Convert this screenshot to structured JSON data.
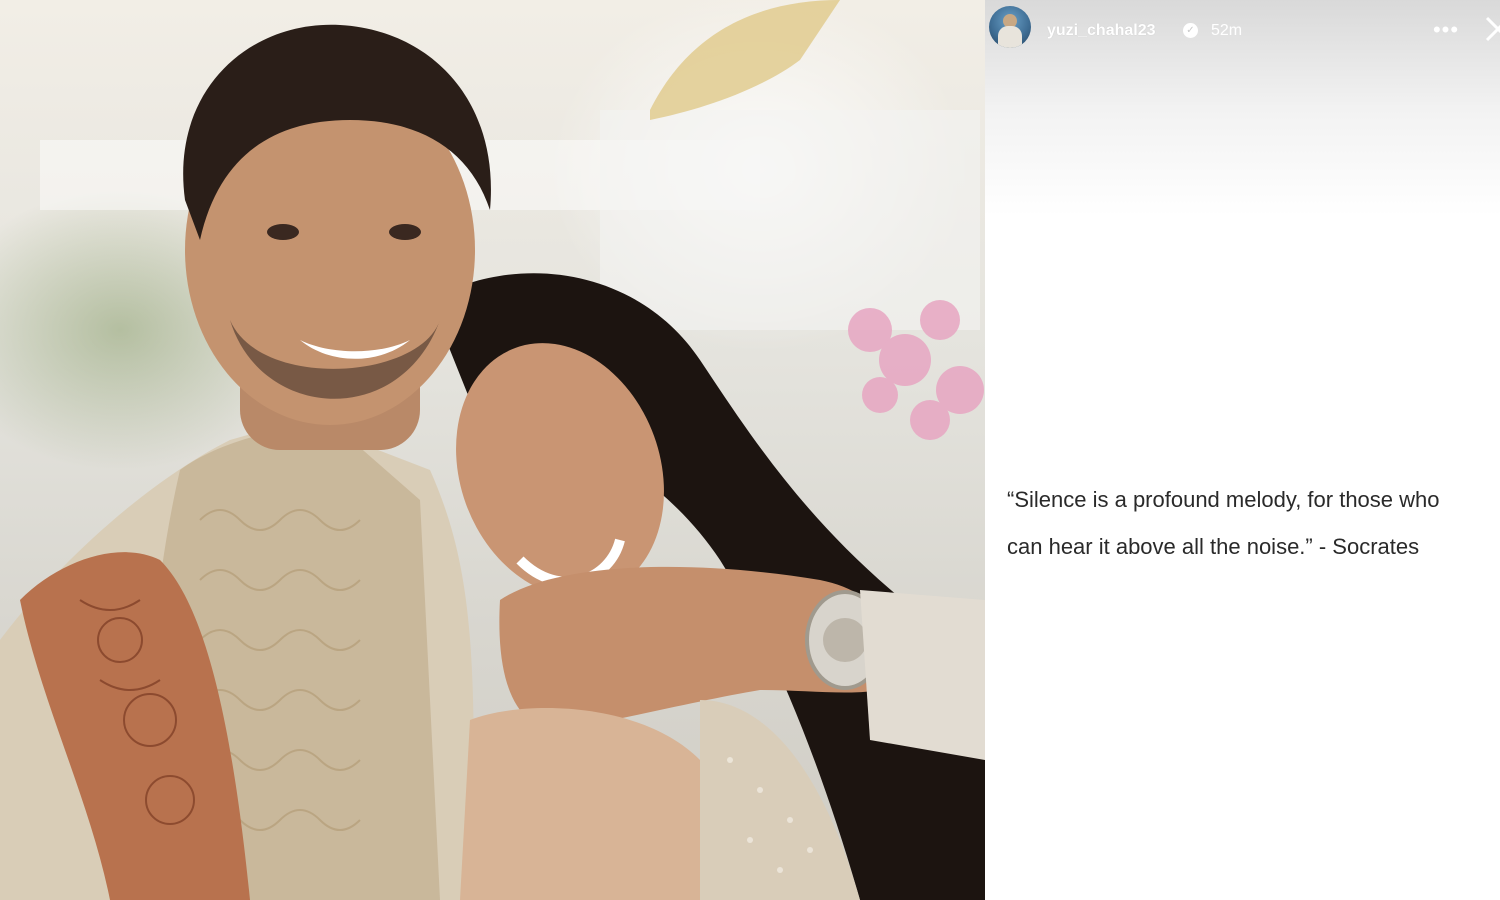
{
  "photo": {
    "subject": "couple-embrace-photo"
  },
  "story": {
    "username": "yuzi_chahal23",
    "verified_icon": "verified-badge-icon",
    "time_ago": "52m",
    "more_icon": "more-options-icon",
    "more_glyph": "•••",
    "close_icon": "close-icon",
    "quote_line1": "“Silence is a profound melody, for those who",
    "quote_line2": "can hear it above all the noise.” - Socrates"
  }
}
